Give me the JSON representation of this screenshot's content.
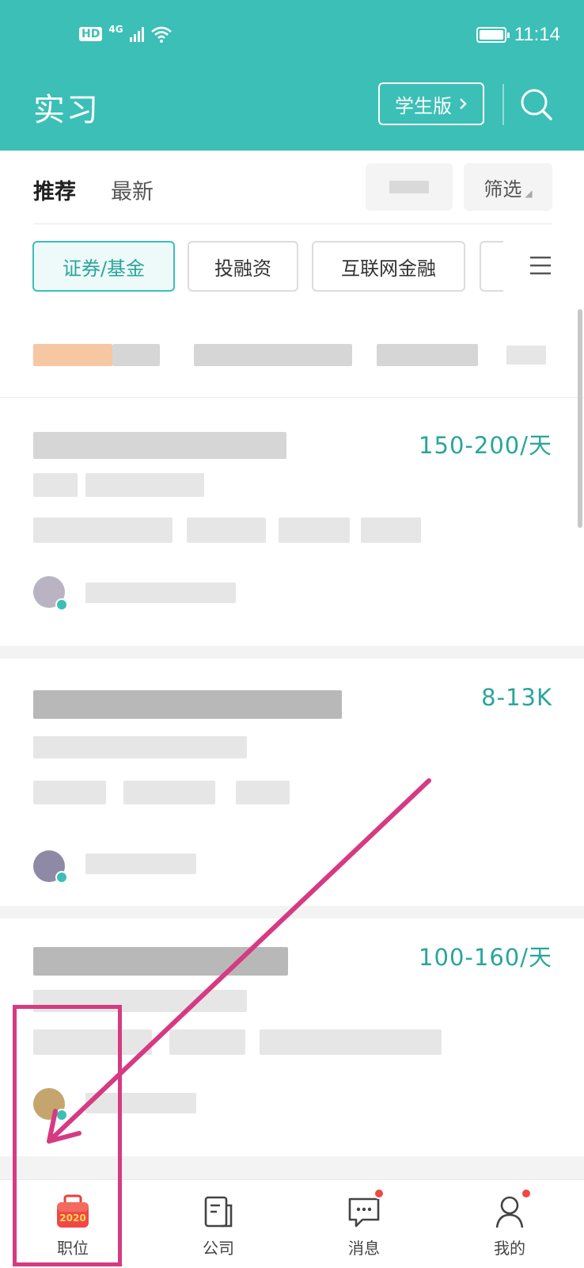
{
  "status_bar": {
    "hd": "HD",
    "network": "4G",
    "time": "11:14"
  },
  "header": {
    "title": "实习",
    "student_button": "学生版",
    "search_icon": "search-icon",
    "bg_color": "#3bbfb6"
  },
  "tabs": {
    "items": [
      {
        "label": "推荐",
        "active": true
      },
      {
        "label": "最新",
        "active": false
      }
    ],
    "filter_label": "筛选"
  },
  "categories": {
    "items": [
      {
        "label": "证券/基金",
        "active": true
      },
      {
        "label": "投融资",
        "active": false
      },
      {
        "label": "互联网金融",
        "active": false
      }
    ],
    "menu_icon": "menu-icon"
  },
  "jobs": [
    {
      "salary": "150-200/天"
    },
    {
      "salary": "8-13K"
    },
    {
      "salary": "100-160/天"
    }
  ],
  "bottom_nav": {
    "items": [
      {
        "label": "职位",
        "icon": "briefcase-2020-icon",
        "active": true,
        "badge": "2020"
      },
      {
        "label": "公司",
        "icon": "company-icon",
        "active": false
      },
      {
        "label": "消息",
        "icon": "message-icon",
        "active": false,
        "dot": true
      },
      {
        "label": "我的",
        "icon": "profile-icon",
        "active": false,
        "dot": true
      }
    ]
  },
  "colors": {
    "accent": "#3bbfb6",
    "salary": "#2aa59c",
    "annotation": "#d63a83",
    "notification_dot": "#f04848"
  }
}
